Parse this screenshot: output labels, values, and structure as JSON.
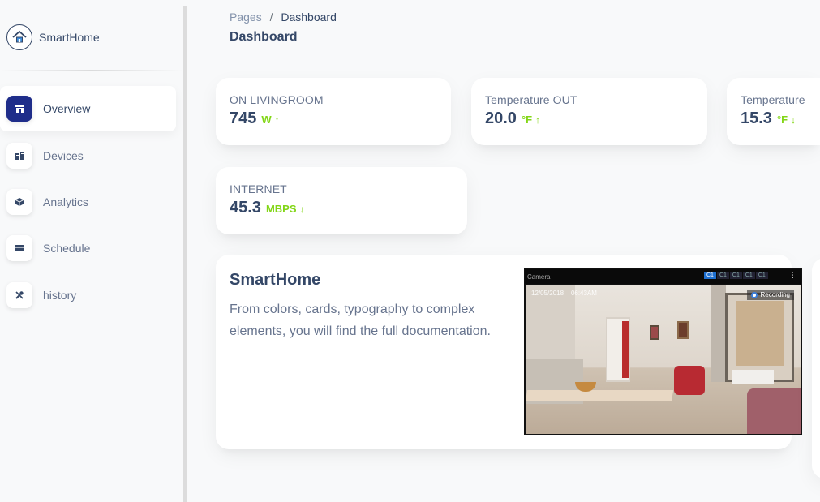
{
  "brand": {
    "name": "SmartHome",
    "logo_icon": "house-logo-icon"
  },
  "sidebar": {
    "items": [
      {
        "label": "Overview",
        "icon": "storefront-icon",
        "active": true
      },
      {
        "label": "Devices",
        "icon": "devices-icon",
        "active": false
      },
      {
        "label": "Analytics",
        "icon": "cube-icon",
        "active": false
      },
      {
        "label": "Schedule",
        "icon": "credit-card-icon",
        "active": false
      },
      {
        "label": "history",
        "icon": "tools-icon",
        "active": false
      }
    ]
  },
  "header": {
    "breadcrumb_root": "Pages",
    "breadcrumb_separator": "/",
    "breadcrumb_current": "Dashboard",
    "title": "Dashboard"
  },
  "stats": [
    {
      "label": "ON LIVINGROOM",
      "value": "745",
      "unit": "W",
      "trend": "↑",
      "color": "#82d616"
    },
    {
      "label": "Temperature OUT",
      "value": "20.0",
      "unit": "°F",
      "trend": "↑",
      "color": "#82d616"
    },
    {
      "label": "Temperature",
      "value": "15.3",
      "unit": "°F",
      "trend": "↓",
      "color": "#82d616"
    },
    {
      "label": "INTERNET",
      "value": "45.3",
      "unit": "MBPS",
      "trend": "↓",
      "color": "#82d616"
    }
  ],
  "info": {
    "title": "SmartHome",
    "text": "From colors, cards, typography to complex elements, you will find the full documentation."
  },
  "camera": {
    "title": "Camera",
    "tabs": [
      "C1",
      "C1",
      "C1",
      "C1",
      "C1"
    ],
    "date": "12/05/2018",
    "time": "06:43AM",
    "status": "Recording",
    "menu_icon": "more-vertical-icon"
  }
}
